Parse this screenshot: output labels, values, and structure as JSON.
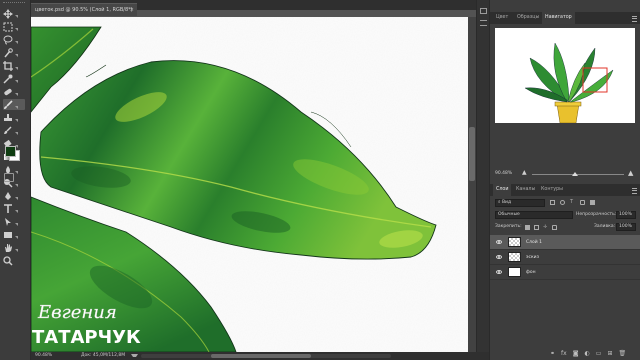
{
  "document": {
    "tab_title": "цветок.psd @ 90.5% (Слой 1, RGB/8*)",
    "close_glyph": "×",
    "zoom": "90.48%",
    "doc_size": "Док: 45,0M/112,8M"
  },
  "toolbar": {
    "tools": [
      "move-tool-icon",
      "marquee-tool-icon",
      "lasso-tool-icon",
      "quick-select-tool-icon",
      "crop-tool-icon",
      "eyedropper-tool-icon",
      "healing-brush-icon",
      "brush-tool-icon",
      "clone-stamp-icon",
      "history-brush-icon",
      "eraser-tool-icon",
      "gradient-tool-icon",
      "blur-tool-icon",
      "dodge-tool-icon",
      "pen-tool-icon",
      "type-tool-icon",
      "path-select-icon",
      "shape-tool-icon",
      "hand-tool-icon",
      "zoom-tool-icon"
    ],
    "foreground_color": "#0f3d12",
    "background_color": "#ffffff"
  },
  "right_panel": {
    "top_tabs": [
      "Цвет",
      "Образцы",
      "Навигатор"
    ],
    "active_top_tab": "Навигатор",
    "navigator_zoom": "90.48%",
    "layers_tabs": [
      "Слои",
      "Каналы",
      "Контуры"
    ],
    "filter_label": "Вид",
    "blend_mode": "Обычные",
    "opacity_label": "Непрозрачность:",
    "opacity_value": "100%",
    "lock_label": "Закрепить:",
    "fill_label": "Заливка:",
    "fill_value": "100%",
    "layers": [
      {
        "name": "Слой 1",
        "selected": true
      },
      {
        "name": "эскиз",
        "selected": false
      },
      {
        "name": "фон",
        "selected": false
      }
    ]
  },
  "watermark": {
    "line1": "Евгения",
    "line2": "ТАТАРЧУК"
  },
  "colors": {
    "leaf_dark": "#1f6e2a",
    "leaf_mid": "#3ea33a",
    "leaf_light": "#a9d63a",
    "nav_frame": "#e0342a"
  }
}
